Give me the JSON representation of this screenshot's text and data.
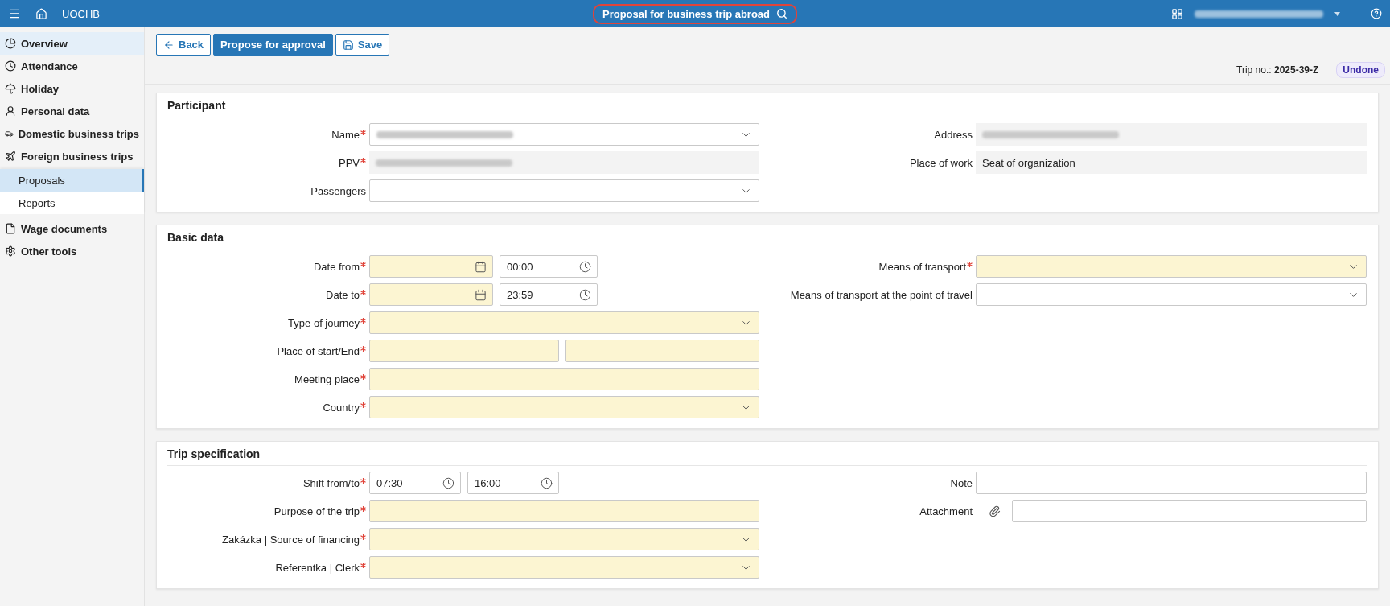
{
  "topbar": {
    "app_name": "UOCHB",
    "title": "Proposal for business trip abroad",
    "user_redacted": true
  },
  "sidebar": {
    "items": [
      {
        "label": "Overview",
        "hovered": true
      },
      {
        "label": "Attendance",
        "hovered": false
      },
      {
        "label": "Holiday",
        "hovered": false
      },
      {
        "label": "Personal data",
        "hovered": false
      },
      {
        "label": "Domestic business trips",
        "hovered": false
      },
      {
        "label": "Foreign business trips",
        "hovered": false,
        "children": [
          {
            "label": "Proposals",
            "selected": true
          },
          {
            "label": "Reports",
            "selected": false
          }
        ]
      },
      {
        "label": "Wage documents",
        "hovered": false
      },
      {
        "label": "Other tools",
        "hovered": false
      }
    ]
  },
  "toolbar": {
    "buttons": [
      {
        "label": "Back",
        "kind": "back"
      },
      {
        "label": "Propose for approval",
        "kind": "primary"
      },
      {
        "label": "Save",
        "kind": "save"
      }
    ]
  },
  "trip": {
    "number": "Trip no.: **2025-39-Z**",
    "status": "Undone"
  },
  "sections": [
    {
      "title": "Participant",
      "left": [
        {
          "label": "Name",
          "required": true,
          "highlighted": false,
          "kind": "select",
          "redacted": true
        },
        {
          "label": "PPV",
          "required": true,
          "kind": "readonly",
          "redacted": true
        },
        {
          "label": "Passengers",
          "required": false,
          "highlighted": false,
          "kind": "select"
        }
      ],
      "right": [
        {
          "label": "Address",
          "required": false,
          "kind": "readonly",
          "redacted": true
        },
        {
          "label": "Place of work",
          "required": false,
          "kind": "readonly",
          "value": "Seat of organization"
        }
      ]
    },
    {
      "title": "Basic data",
      "left": [
        {
          "label": "Date from",
          "required": true,
          "highlighted": true,
          "kind": "datetime",
          "time": "00:00"
        },
        {
          "label": "Date to",
          "required": true,
          "highlighted": true,
          "kind": "datetime",
          "time": "23:59"
        },
        {
          "label": "Type of journey",
          "required": true,
          "highlighted": true,
          "kind": "select"
        },
        {
          "label": "Place of start/End",
          "required": true,
          "highlighted": true,
          "kind": "pair"
        },
        {
          "label": "Meeting place",
          "required": true,
          "highlighted": true,
          "kind": "text"
        },
        {
          "label": "Country",
          "required": true,
          "highlighted": true,
          "kind": "select"
        }
      ],
      "right": [
        {
          "label": "Means of transport",
          "required": true,
          "highlighted": true,
          "kind": "select"
        },
        {
          "label": "Means of transport at the point of travel",
          "required": false,
          "highlighted": false,
          "kind": "select"
        }
      ]
    },
    {
      "title": "Trip specification",
      "left": [
        {
          "label": "Shift from/to",
          "required": true,
          "highlighted": false,
          "kind": "times",
          "values": [
            "07:30",
            "16:00"
          ]
        },
        {
          "label": "Purpose of the trip",
          "required": true,
          "highlighted": true,
          "kind": "text"
        },
        {
          "label": "Zakázka | Source of financing",
          "required": true,
          "highlighted": true,
          "kind": "select"
        },
        {
          "label": "Referentka | Clerk",
          "required": true,
          "highlighted": true,
          "kind": "select"
        }
      ],
      "right": [
        {
          "label": "Note",
          "required": false,
          "highlighted": false,
          "kind": "text"
        },
        {
          "label": "Attachment",
          "required": false,
          "highlighted": false,
          "kind": "attachment"
        }
      ]
    }
  ]
}
